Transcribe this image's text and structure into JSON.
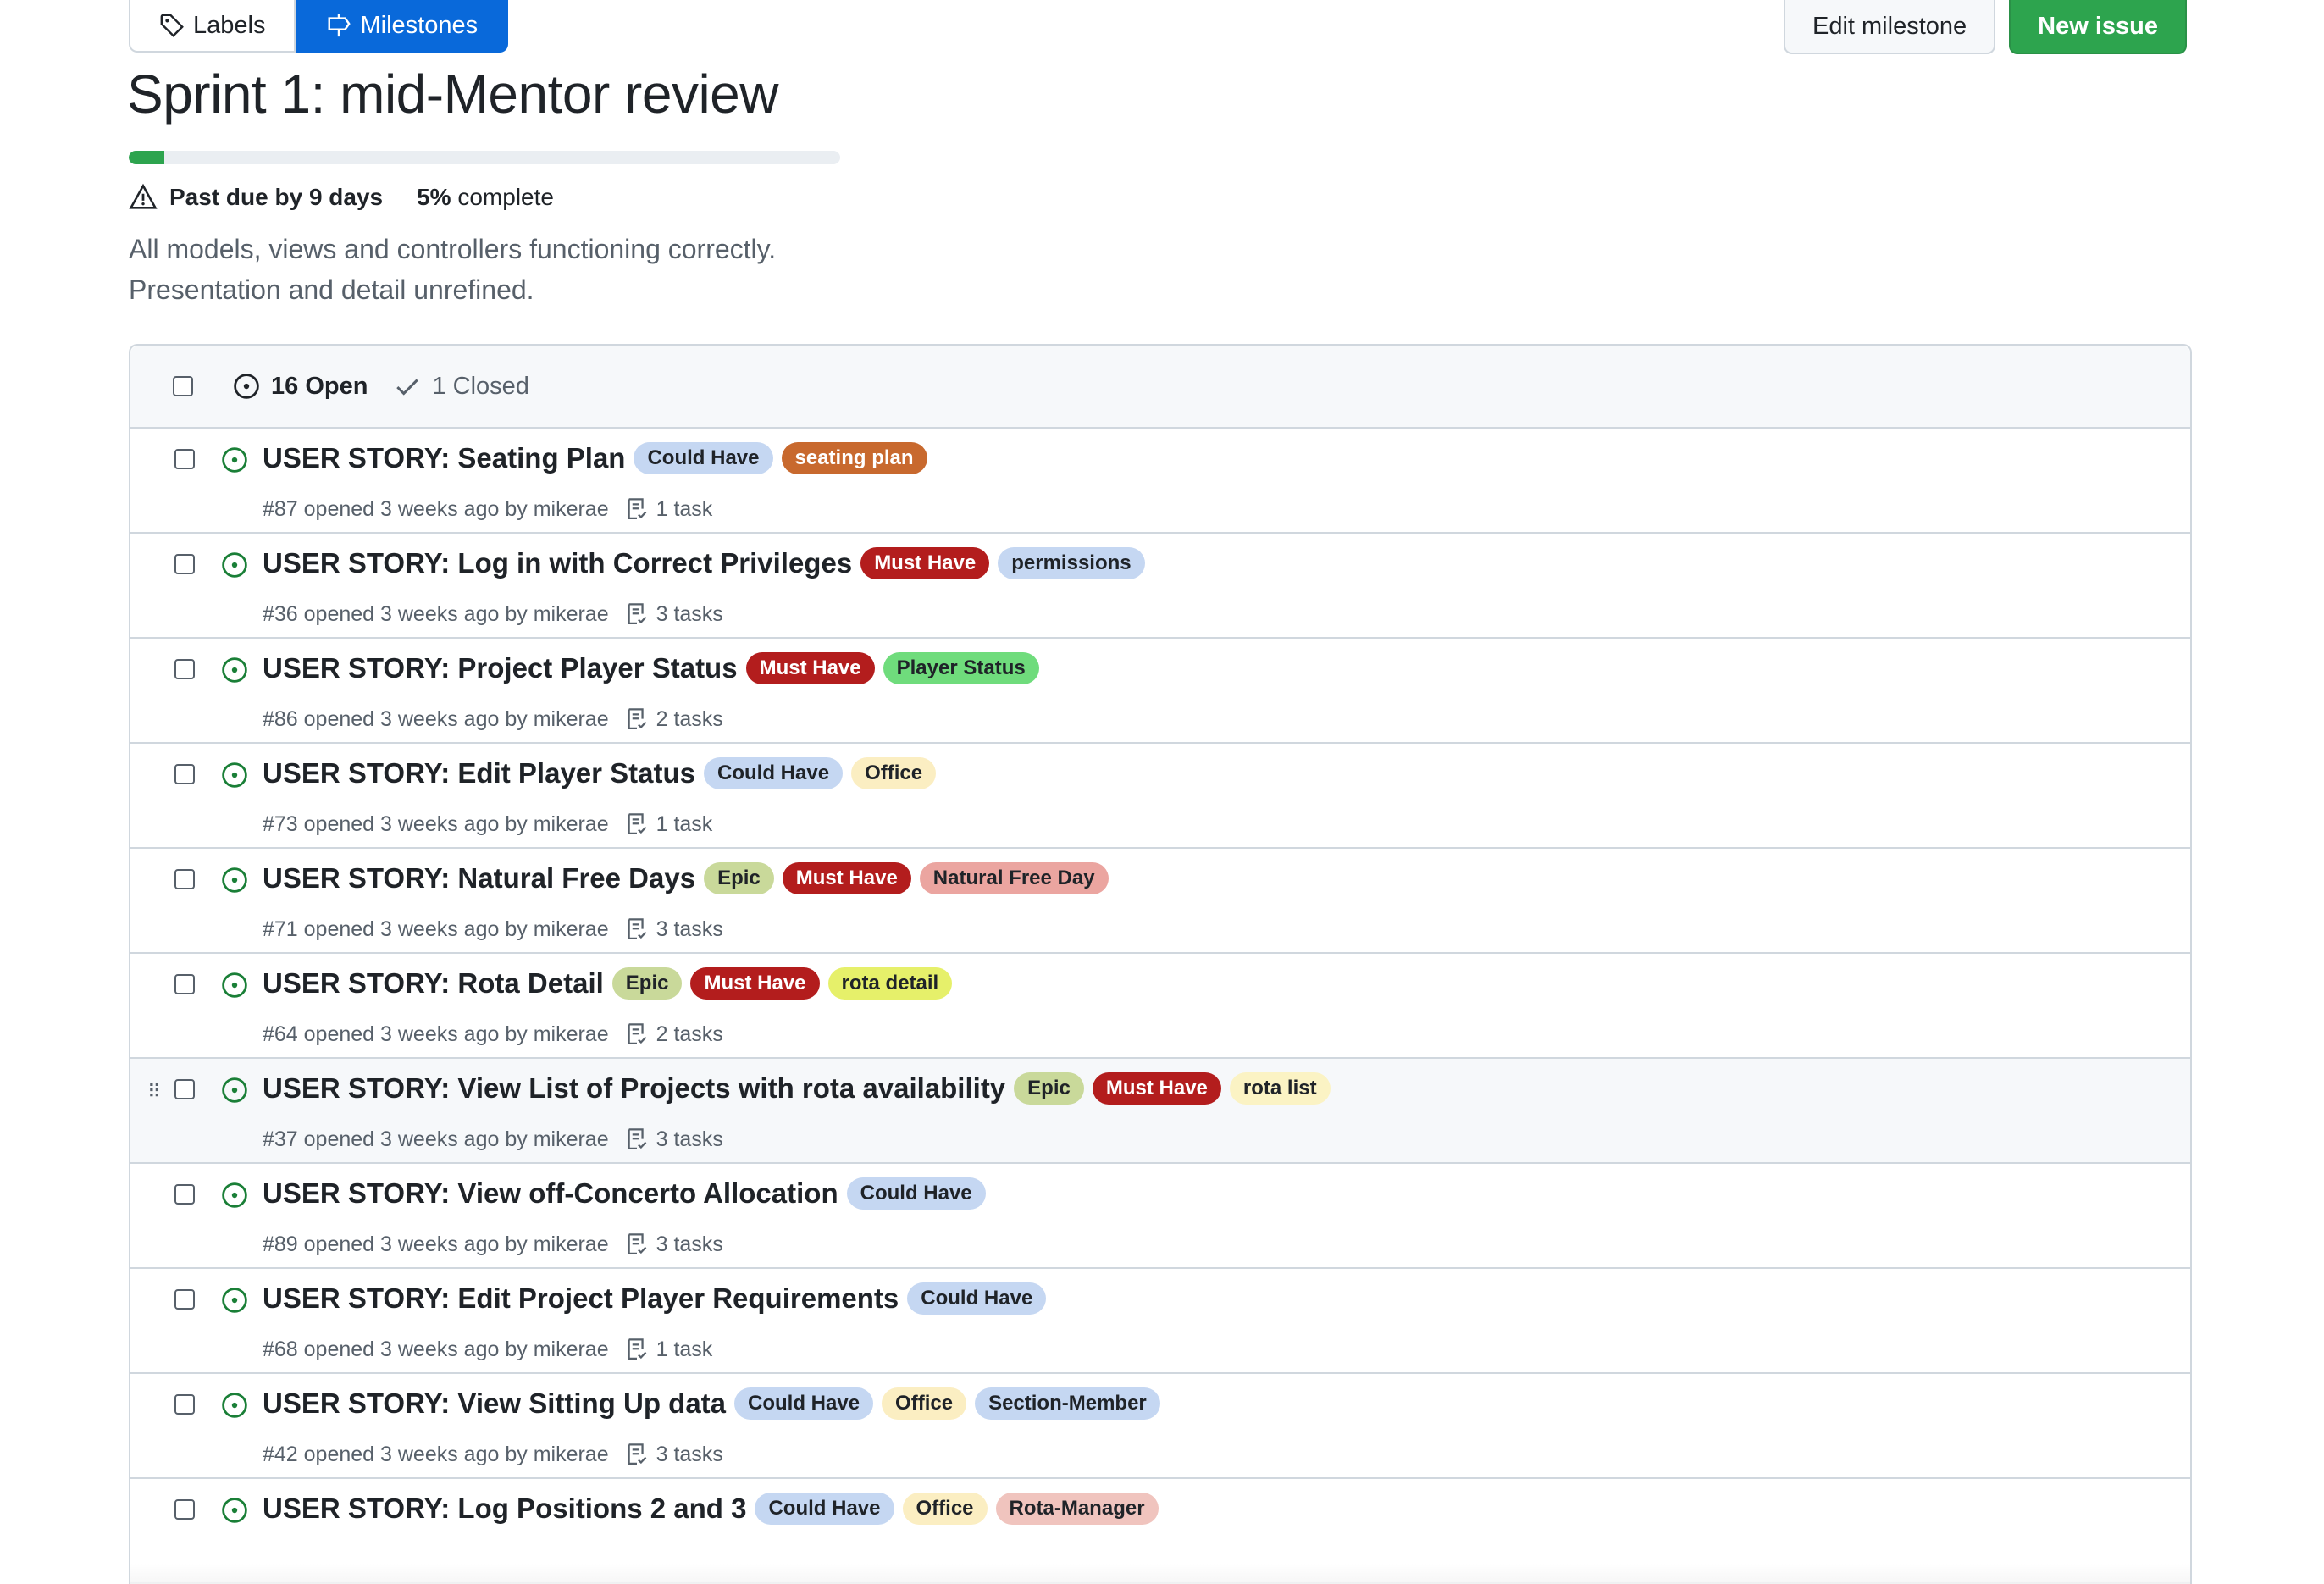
{
  "nav": {
    "labels": "Labels",
    "milestones": "Milestones"
  },
  "actions": {
    "edit": "Edit milestone",
    "new_issue": "New issue"
  },
  "milestone": {
    "title": "Sprint 1: mid-Mentor review",
    "progress_percent": 5,
    "due": "Past due by 9 days",
    "complete_pct": "5%",
    "complete_word": "complete",
    "description_1": "All models, views and controllers functioning correctly.",
    "description_2": "Presentation and detail unrefined."
  },
  "filter": {
    "open": "16 Open",
    "closed": "1 Closed"
  },
  "issues": [
    {
      "title": "USER STORY: Seating Plan",
      "labels": [
        {
          "text": "Could Have",
          "bg": "#c5d7f2",
          "fg": "#1f2328"
        },
        {
          "text": "seating plan",
          "bg": "#c8692e",
          "fg": "#ffffff"
        }
      ],
      "meta": "#87 opened 3 weeks ago by mikerae",
      "tasks": "1 task"
    },
    {
      "title": "USER STORY: Log in with Correct Privileges",
      "labels": [
        {
          "text": "Must Have",
          "bg": "#b31d1d",
          "fg": "#ffffff"
        },
        {
          "text": "permissions",
          "bg": "#c5d7f2",
          "fg": "#1f2328"
        }
      ],
      "meta": "#36 opened 3 weeks ago by mikerae",
      "tasks": "3 tasks"
    },
    {
      "title": "USER STORY: Project Player Status",
      "labels": [
        {
          "text": "Must Have",
          "bg": "#b31d1d",
          "fg": "#ffffff"
        },
        {
          "text": "Player Status",
          "bg": "#6fdc7c",
          "fg": "#1f2328"
        }
      ],
      "meta": "#86 opened 3 weeks ago by mikerae",
      "tasks": "2 tasks"
    },
    {
      "title": "USER STORY: Edit Player Status",
      "labels": [
        {
          "text": "Could Have",
          "bg": "#c5d7f2",
          "fg": "#1f2328"
        },
        {
          "text": "Office",
          "bg": "#fbeec2",
          "fg": "#1f2328"
        }
      ],
      "meta": "#73 opened 3 weeks ago by mikerae",
      "tasks": "1 task"
    },
    {
      "title": "USER STORY: Natural Free Days",
      "labels": [
        {
          "text": "Epic",
          "bg": "#c9d99a",
          "fg": "#1f2328"
        },
        {
          "text": "Must Have",
          "bg": "#b31d1d",
          "fg": "#ffffff"
        },
        {
          "text": "Natural Free Day",
          "bg": "#eba5a0",
          "fg": "#1f2328"
        }
      ],
      "meta": "#71 opened 3 weeks ago by mikerae",
      "tasks": "3 tasks"
    },
    {
      "title": "USER STORY: Rota Detail",
      "labels": [
        {
          "text": "Epic",
          "bg": "#c9d99a",
          "fg": "#1f2328"
        },
        {
          "text": "Must Have",
          "bg": "#b31d1d",
          "fg": "#ffffff"
        },
        {
          "text": "rota detail",
          "bg": "#e6f06a",
          "fg": "#1f2328"
        }
      ],
      "meta": "#64 opened 3 weeks ago by mikerae",
      "tasks": "2 tasks"
    },
    {
      "title": "USER STORY: View List of Projects with rota availability",
      "labels": [
        {
          "text": "Epic",
          "bg": "#c9d99a",
          "fg": "#1f2328"
        },
        {
          "text": "Must Have",
          "bg": "#b31d1d",
          "fg": "#ffffff"
        },
        {
          "text": "rota list",
          "bg": "#fbf3c4",
          "fg": "#1f2328"
        }
      ],
      "meta": "#37 opened 3 weeks ago by mikerae",
      "tasks": "3 tasks",
      "hover": true
    },
    {
      "title": "USER STORY: View off-Concerto Allocation",
      "labels": [
        {
          "text": "Could Have",
          "bg": "#c5d7f2",
          "fg": "#1f2328"
        }
      ],
      "meta": "#89 opened 3 weeks ago by mikerae",
      "tasks": "3 tasks"
    },
    {
      "title": "USER STORY: Edit Project Player Requirements",
      "labels": [
        {
          "text": "Could Have",
          "bg": "#c5d7f2",
          "fg": "#1f2328"
        }
      ],
      "meta": "#68 opened 3 weeks ago by mikerae",
      "tasks": "1 task"
    },
    {
      "title": "USER STORY: View Sitting Up data",
      "labels": [
        {
          "text": "Could Have",
          "bg": "#c5d7f2",
          "fg": "#1f2328"
        },
        {
          "text": "Office",
          "bg": "#fbeec2",
          "fg": "#1f2328"
        },
        {
          "text": "Section-Member",
          "bg": "#c5d7f2",
          "fg": "#1f2328"
        }
      ],
      "meta": "#42 opened 3 weeks ago by mikerae",
      "tasks": "3 tasks"
    },
    {
      "title": "USER STORY: Log Positions 2 and 3",
      "labels": [
        {
          "text": "Could Have",
          "bg": "#c5d7f2",
          "fg": "#1f2328"
        },
        {
          "text": "Office",
          "bg": "#fbeec2",
          "fg": "#1f2328"
        },
        {
          "text": "Rota-Manager",
          "bg": "#f0c4be",
          "fg": "#1f2328"
        }
      ],
      "meta": "",
      "tasks": ""
    }
  ],
  "colors": {
    "accent": "#0969da",
    "success": "#2da44e",
    "open_icon": "#1a7f37"
  }
}
